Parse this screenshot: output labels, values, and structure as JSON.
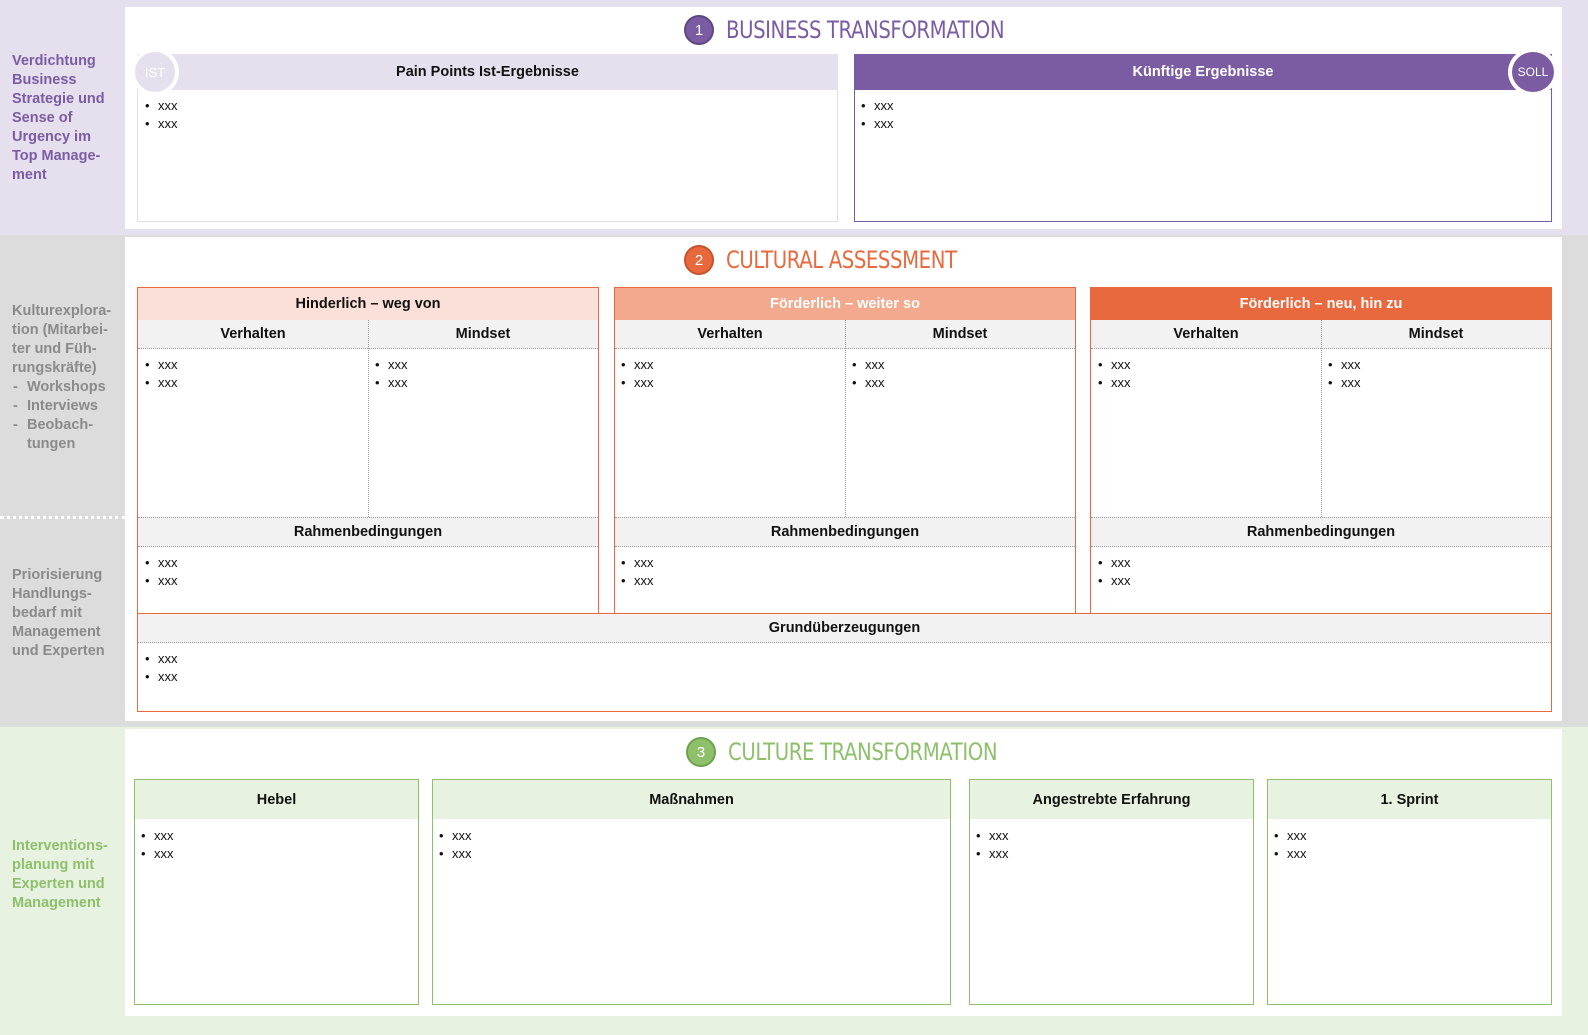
{
  "colors": {
    "purple": "#7b5ca3",
    "purple_light": "#e6e0ee",
    "orange": "#e8693e",
    "orange_mid": "#f3a98d",
    "orange_light": "#fbe0d9",
    "green": "#8ec06c",
    "green_light": "#e8f2e0",
    "grey_band": "#dcdcdc",
    "grey_header": "#f2f2f2"
  },
  "sections": {
    "business": {
      "number": "1",
      "title": "BUSINESS TRANSFORMATION",
      "side_text": "Verdichtung Business Strategie und Sense of Urgency im Top Manage-ment",
      "ist_badge": "IST",
      "soll_badge": "SOLL",
      "left": {
        "header": "Pain Points Ist-Ergebnisse",
        "items": [
          "xxx",
          "xxx"
        ]
      },
      "right": {
        "header": "Künftige Ergebnisse",
        "items": [
          "xxx",
          "xxx"
        ]
      }
    },
    "cultural": {
      "number": "2",
      "title": "CULTURAL ASSESSMENT",
      "side_top": {
        "text": "Kulturexplora-tion (Mitarbei-ter und Füh-rungskräfte)",
        "sub": [
          "Workshops",
          "Interviews",
          "Beobach-tungen"
        ]
      },
      "side_bottom": "Priorisierung Handlungs-bedarf mit Management und Experten",
      "columns": [
        {
          "header": "Hinderlich – weg von",
          "verhalten": "Verhalten",
          "mindset": "Mindset",
          "verhalten_items": [
            "xxx",
            "xxx"
          ],
          "mindset_items": [
            "xxx",
            "xxx"
          ],
          "rahmen": "Rahmenbedingungen",
          "rahmen_items": [
            "xxx",
            "xxx"
          ]
        },
        {
          "header": "Förderlich – weiter so",
          "verhalten": "Verhalten",
          "mindset": "Mindset",
          "verhalten_items": [
            "xxx",
            "xxx"
          ],
          "mindset_items": [
            "xxx",
            "xxx"
          ],
          "rahmen": "Rahmenbedingungen",
          "rahmen_items": [
            "xxx",
            "xxx"
          ]
        },
        {
          "header": "Förderlich – neu, hin zu",
          "verhalten": "Verhalten",
          "mindset": "Mindset",
          "verhalten_items": [
            "xxx",
            "xxx"
          ],
          "mindset_items": [
            "xxx",
            "xxx"
          ],
          "rahmen": "Rahmenbedingungen",
          "rahmen_items": [
            "xxx",
            "xxx"
          ]
        }
      ],
      "grund": {
        "header": "Grundüberzeugungen",
        "items": [
          "xxx",
          "xxx"
        ]
      }
    },
    "culture": {
      "number": "3",
      "title": "CULTURE TRANSFORMATION",
      "side_text": "Interventions-planung mit Experten und Management",
      "boxes": [
        {
          "header": "Hebel",
          "items": [
            "xxx",
            "xxx"
          ]
        },
        {
          "header": "Maßnahmen",
          "items": [
            "xxx",
            "xxx"
          ]
        },
        {
          "header": "Angestrebte Erfahrung",
          "items": [
            "xxx",
            "xxx"
          ]
        },
        {
          "header": "1. Sprint",
          "items": [
            "xxx",
            "xxx"
          ]
        }
      ]
    }
  }
}
